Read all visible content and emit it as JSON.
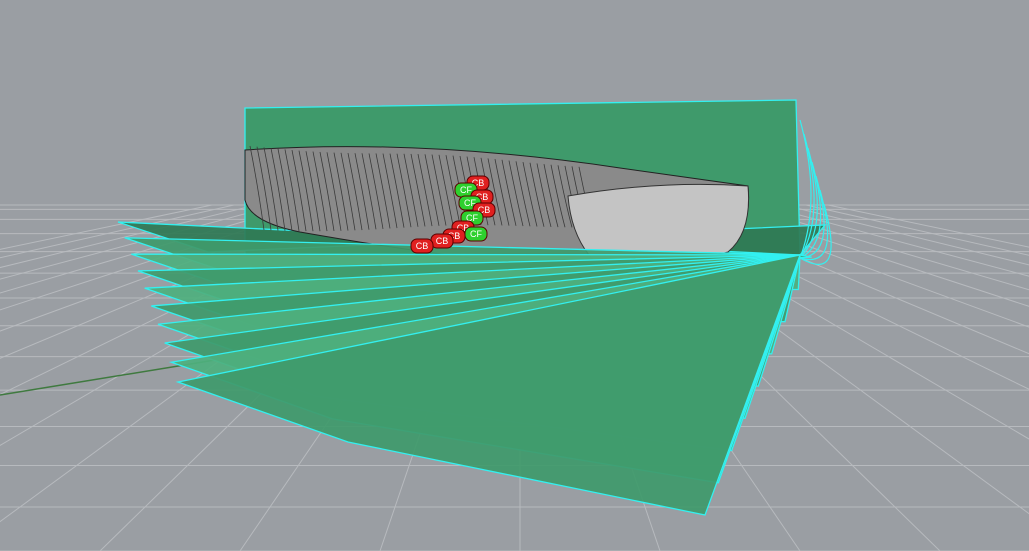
{
  "viewport": {
    "background": "#9a9ea3",
    "grid_color": "#b7babe",
    "axis_x_color": "#8f3a3a",
    "axis_y_color": "#3f7a3f"
  },
  "planes": {
    "fill": "#3f9a6b",
    "fill_light": "#4eb07e",
    "fill_dark": "#2f7a55",
    "edge": "#33f0f0",
    "count": 10
  },
  "hull": {
    "body_color": "#8a8a8a",
    "section_color": "#3a3a3a",
    "cap_color": "#c4c4c4"
  },
  "markers": {
    "cb_color": "#e02020",
    "cf_color": "#2ed02e",
    "outline": "#5a0000",
    "items": [
      {
        "label": "CB",
        "kind": "cb"
      },
      {
        "label": "CF",
        "kind": "cf"
      },
      {
        "label": "CB",
        "kind": "cb"
      },
      {
        "label": "CF",
        "kind": "cf"
      },
      {
        "label": "CB",
        "kind": "cb"
      },
      {
        "label": "CF",
        "kind": "cf"
      },
      {
        "label": "CB",
        "kind": "cb"
      },
      {
        "label": "CF",
        "kind": "cf"
      },
      {
        "label": "CB",
        "kind": "cb"
      },
      {
        "label": "CB",
        "kind": "cb"
      },
      {
        "label": "CB",
        "kind": "cb"
      }
    ]
  }
}
